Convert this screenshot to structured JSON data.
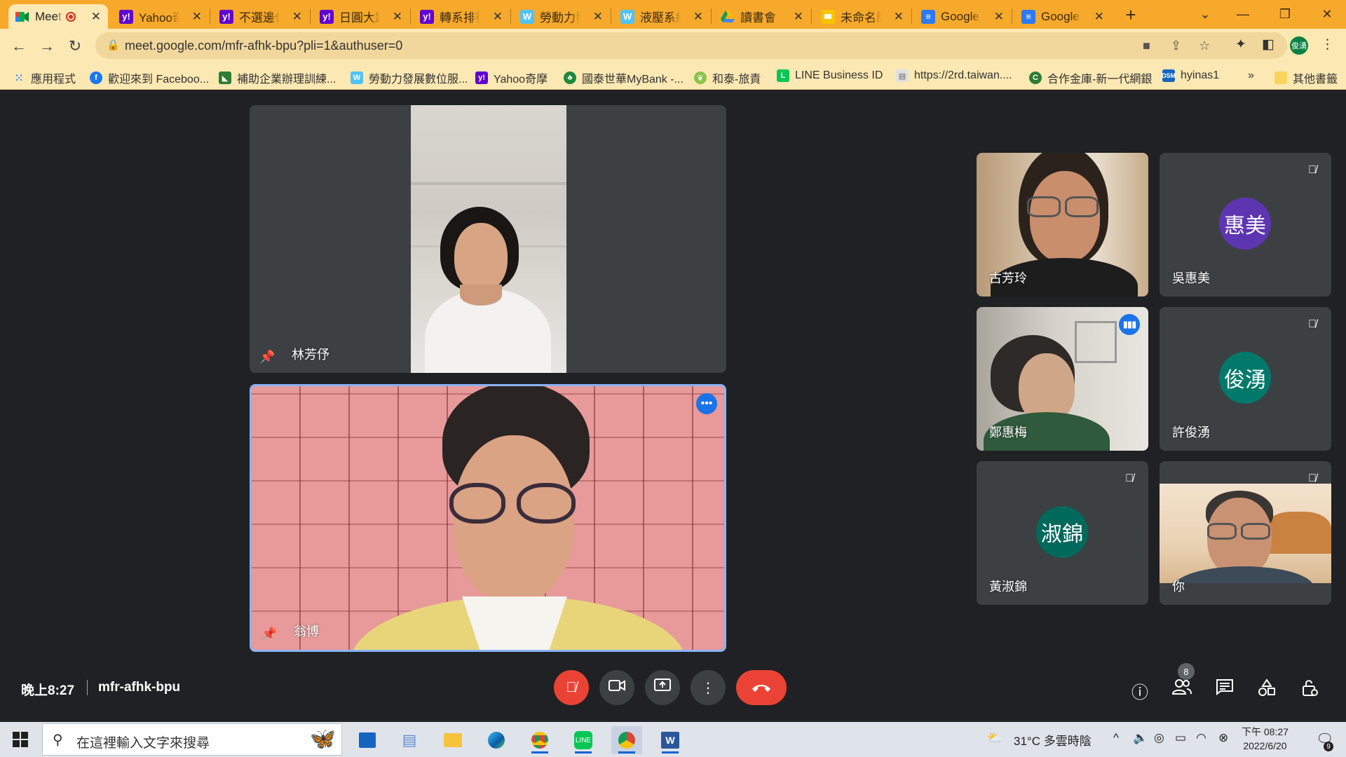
{
  "tabs": [
    {
      "title": "Meet",
      "icon": "meet-icon",
      "active": true
    },
    {
      "title": "Yahoo奇摩",
      "icon": "yahoo-icon"
    },
    {
      "title": "不選邊任",
      "icon": "yahoo-icon"
    },
    {
      "title": "日圓大跌",
      "icon": "yahoo-icon"
    },
    {
      "title": "轉系排行",
      "icon": "yahoo-icon"
    },
    {
      "title": "勞動力發",
      "icon": "w-icon"
    },
    {
      "title": "液壓系統",
      "icon": "w-icon"
    },
    {
      "title": "讀書會 -",
      "icon": "drive-icon"
    },
    {
      "title": "未命名簡",
      "icon": "slides-icon"
    },
    {
      "title": "Google",
      "icon": "docs-icon"
    },
    {
      "title": "Google",
      "icon": "docs-icon"
    }
  ],
  "toolbar": {
    "url": "meet.google.com/mfr-afhk-bpu?pli=1&authuser=0",
    "profile_label": "俊湧"
  },
  "bookmarks": [
    {
      "label": "應用程式"
    },
    {
      "label": "歡迎來到 Faceboo..."
    },
    {
      "label": "補助企業辦理訓練..."
    },
    {
      "label": "勞動力發展數位服..."
    },
    {
      "label": "Yahoo奇摩"
    },
    {
      "label": "國泰世華MyBank -..."
    },
    {
      "label": "和泰-旅責"
    },
    {
      "label": "LINE Business ID"
    },
    {
      "label": "https://2rd.taiwan...."
    },
    {
      "label": "合作金庫-新一代網銀"
    },
    {
      "label": "hyinas1"
    },
    {
      "label": "»"
    },
    {
      "label": "其他書籤"
    }
  ],
  "participants": {
    "main_top": {
      "name": "林芳伃"
    },
    "main_bottom": {
      "name": "翁博"
    },
    "grid": [
      {
        "name": "古芳玲"
      },
      {
        "name": "吳惠美",
        "avatar": "惠美",
        "avatar_color": "#5e35b1"
      },
      {
        "name": "鄭惠梅"
      },
      {
        "name": "許俊湧",
        "avatar": "俊湧",
        "avatar_color": "#00796b"
      },
      {
        "name": "黃淑錦",
        "avatar": "淑錦",
        "avatar_color": "#00695c"
      },
      {
        "name": "你"
      }
    ]
  },
  "meeting": {
    "time": "晚上8:27",
    "code": "mfr-afhk-bpu",
    "participant_count": "8"
  },
  "taskbar": {
    "search_placeholder": "在這裡輸入文字來搜尋",
    "weather": "31°C 多雲時陰",
    "clock_time": "下午 08:27",
    "clock_date": "2022/6/20",
    "notification_count": "9"
  },
  "colors": {
    "tab_strip": "#f7a92b",
    "toolbar": "#fce8b2",
    "meet_bg": "#202124",
    "tile_bg": "#3c4043",
    "end_call": "#ea4335",
    "active_speaker": "#1a73e8"
  }
}
